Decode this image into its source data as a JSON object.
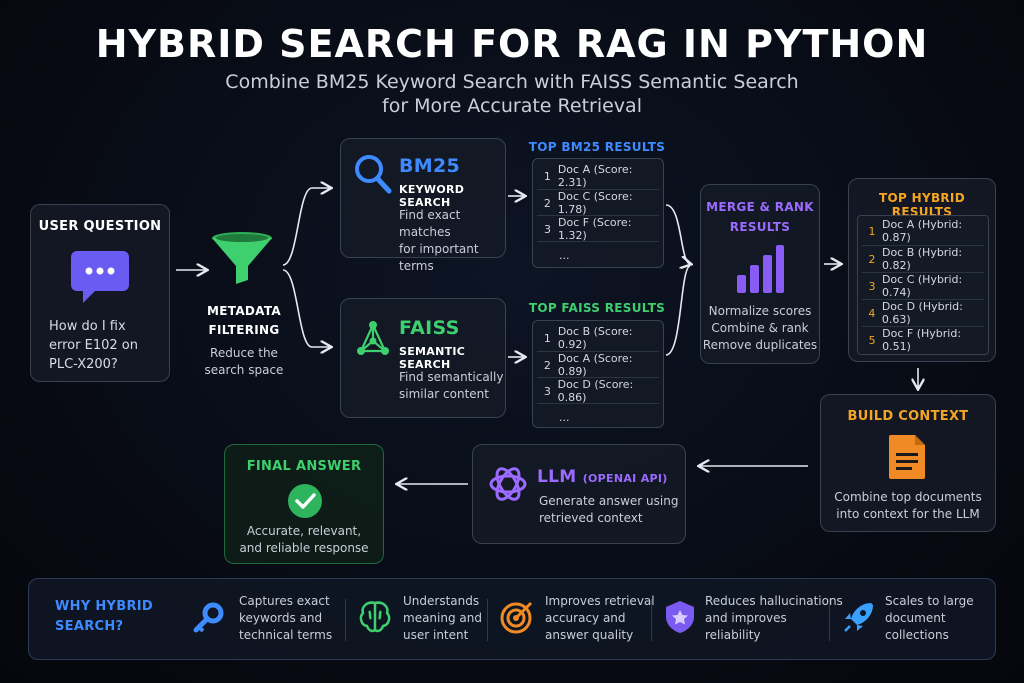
{
  "title": "HYBRID SEARCH FOR RAG IN PYTHON",
  "subtitle_line1": "Combine BM25 Keyword Search with FAISS Semantic Search",
  "subtitle_line2": "for More Accurate Retrieval",
  "user_question": {
    "header": "USER QUESTION",
    "text": "How do I fix error E102 on PLC-X200?"
  },
  "metadata": {
    "title_line1": "METADATA",
    "title_line2": "FILTERING",
    "desc_line1": "Reduce the",
    "desc_line2": "search space"
  },
  "bm25": {
    "title": "BM25",
    "subtitle": "KEYWORD SEARCH",
    "desc_line1": "Find exact matches",
    "desc_line2": "for important terms"
  },
  "faiss": {
    "title": "FAISS",
    "subtitle": "SEMANTIC SEARCH",
    "desc_line1": "Find semantically",
    "desc_line2": "similar content"
  },
  "bm25_results": {
    "header": "TOP BM25 RESULTS",
    "rows": [
      {
        "n": "1",
        "text": "Doc A (Score: 2.31)"
      },
      {
        "n": "2",
        "text": "Doc C (Score: 1.78)"
      },
      {
        "n": "3",
        "text": "Doc F (Score: 1.32)"
      },
      {
        "n": "",
        "text": "..."
      }
    ]
  },
  "faiss_results": {
    "header": "TOP FAISS RESULTS",
    "rows": [
      {
        "n": "1",
        "text": "Doc B (Score: 0.92)"
      },
      {
        "n": "2",
        "text": "Doc A (Score: 0.89)"
      },
      {
        "n": "3",
        "text": "Doc D (Score: 0.86)"
      },
      {
        "n": "",
        "text": "..."
      }
    ]
  },
  "merge": {
    "title_line1": "MERGE & RANK",
    "title_line2": "RESULTS",
    "desc_line1": "Normalize scores",
    "desc_line2": "Combine & rank",
    "desc_line3": "Remove duplicates"
  },
  "hybrid_results": {
    "header": "TOP HYBRID RESULTS",
    "rows": [
      {
        "n": "1",
        "text": "Doc A (Hybrid: 0.87)"
      },
      {
        "n": "2",
        "text": "Doc B (Hybrid: 0.82)"
      },
      {
        "n": "3",
        "text": "Doc C (Hybrid: 0.74)"
      },
      {
        "n": "4",
        "text": "Doc D (Hybrid: 0.63)"
      },
      {
        "n": "5",
        "text": "Doc F (Hybrid: 0.51)"
      }
    ]
  },
  "build_context": {
    "header": "BUILD CONTEXT",
    "desc_line1": "Combine top documents",
    "desc_line2": "into context for the LLM"
  },
  "llm": {
    "title": "LLM",
    "api": "(OPENAI API)",
    "desc_line1": "Generate answer using",
    "desc_line2": "retrieved context"
  },
  "final_answer": {
    "header": "FINAL ANSWER",
    "desc_line1": "Accurate, relevant,",
    "desc_line2": "and reliable response"
  },
  "why": {
    "header_line1": "WHY HYBRID",
    "header_line2": "SEARCH?",
    "items": [
      {
        "icon": "key-icon",
        "l1": "Captures exact",
        "l2": "keywords and",
        "l3": "technical terms"
      },
      {
        "icon": "brain-icon",
        "l1": "Understands",
        "l2": "meaning and",
        "l3": "user intent"
      },
      {
        "icon": "target-icon",
        "l1": "Improves retrieval",
        "l2": "accuracy and",
        "l3": "answer quality"
      },
      {
        "icon": "shield-icon",
        "l1": "Reduces hallucinations",
        "l2": "and improves",
        "l3": "reliability"
      },
      {
        "icon": "rocket-icon",
        "l1": "Scales to large",
        "l2": "document",
        "l3": "collections"
      }
    ]
  },
  "colors": {
    "bm25_blue": "#3d8bff",
    "faiss_green": "#3ecf6e",
    "merge_purple": "#9b6bff",
    "hybrid_orange": "#f5a524",
    "final_green": "#33c46a"
  }
}
